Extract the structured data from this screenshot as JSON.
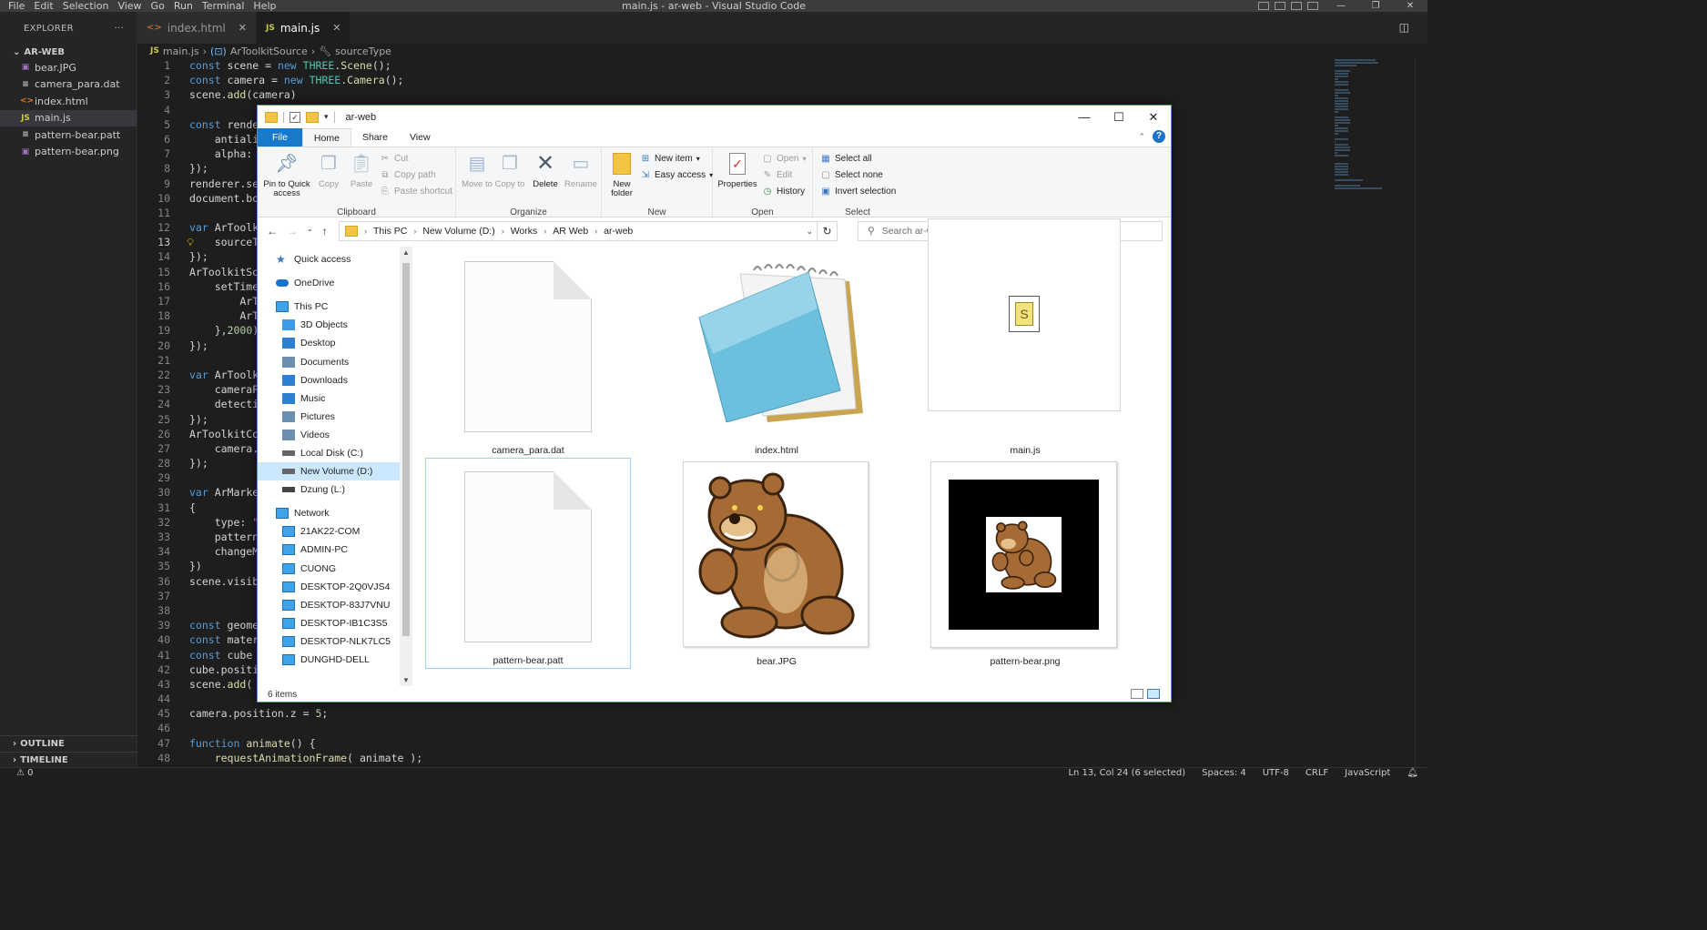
{
  "vscode": {
    "title": "main.js - ar-web - Visual Studio Code",
    "menu": [
      "File",
      "Edit",
      "Selection",
      "View",
      "Go",
      "Run",
      "Terminal",
      "Help"
    ],
    "explorer_label": "EXPLORER",
    "project": "AR-WEB",
    "files": [
      {
        "name": "bear.JPG",
        "icon": "image-icon",
        "color": "#a074c4"
      },
      {
        "name": "camera_para.dat",
        "icon": "file-icon",
        "color": "#cccccc"
      },
      {
        "name": "index.html",
        "icon": "html-icon",
        "color": "#e37933"
      },
      {
        "name": "main.js",
        "icon": "js-icon",
        "color": "#cbcb41",
        "active": true
      },
      {
        "name": "pattern-bear.patt",
        "icon": "file-icon",
        "color": "#cccccc"
      },
      {
        "name": "pattern-bear.png",
        "icon": "image-icon",
        "color": "#a074c4"
      }
    ],
    "outline_label": "OUTLINE",
    "timeline_label": "TIMELINE",
    "tabs": [
      {
        "label": "index.html",
        "icon": "html-icon"
      },
      {
        "label": "main.js",
        "icon": "js-icon",
        "active": true
      }
    ],
    "breadcrumb": [
      "main.js",
      "ArToolkitSource",
      "sourceType"
    ],
    "current_line": 13,
    "status": {
      "left": "⚠ 0",
      "position": "Ln 13, Col 24 (6 selected)",
      "spaces": "Spaces: 4",
      "encoding": "UTF-8",
      "eol": "CRLF",
      "language": "JavaScript"
    },
    "code_lines": [
      "const scene = new THREE.Scene();",
      "const camera = new THREE.Camera();",
      "scene.add(camera)",
      "",
      "const render",
      "    antiali",
      "    alpha: ",
      "});",
      "renderer.se",
      "document.bo",
      "",
      "var ArToolk",
      "    sourceTy",
      "});",
      "ArToolkitSo",
      "    setTime",
      "        ArT",
      "        ArT",
      "    },2000)",
      "});",
      "",
      "var ArToolk",
      "    cameraPa",
      "    detectio",
      "});",
      "ArToolkitCo",
      "    camera.",
      "});",
      "",
      "var ArMarke",
      "{",
      "    type: \"",
      "    patternU",
      "    changeMa",
      "})",
      "scene.visib",
      "",
      "",
      "const geome",
      "const mater",
      "const cube ",
      "cube.positi",
      "scene.add( ",
      "",
      "camera.position.z = 5;",
      "",
      "function animate() {",
      "    requestAnimationFrame( animate );",
      ""
    ]
  },
  "file_explorer": {
    "title": "ar-web",
    "ribbon_tabs": [
      "File",
      "Home",
      "Share",
      "View"
    ],
    "clipboard": {
      "label": "Clipboard",
      "pin": "Pin to Quick access",
      "copy": "Copy",
      "paste": "Paste",
      "cut": "Cut",
      "copy_path": "Copy path",
      "paste_shortcut": "Paste shortcut"
    },
    "organize": {
      "label": "Organize",
      "move_to": "Move to",
      "copy_to": "Copy to",
      "delete": "Delete",
      "rename": "Rename"
    },
    "new": {
      "label": "New",
      "new_folder": "New folder",
      "new_item": "New item",
      "easy_access": "Easy access"
    },
    "open": {
      "label": "Open",
      "properties": "Properties",
      "open": "Open",
      "edit": "Edit",
      "history": "History"
    },
    "select": {
      "label": "Select",
      "select_all": "Select all",
      "select_none": "Select none",
      "invert": "Invert selection"
    },
    "address": [
      "This PC",
      "New Volume (D:)",
      "Works",
      "AR Web",
      "ar-web"
    ],
    "search_placeholder": "Search ar-web",
    "nav": {
      "quick_access": "Quick access",
      "onedrive": "OneDrive",
      "this_pc": "This PC",
      "pc_items": [
        "3D Objects",
        "Desktop",
        "Documents",
        "Downloads",
        "Music",
        "Pictures",
        "Videos",
        "Local Disk (C:)",
        "New Volume (D:)",
        "Dzung (L:)"
      ],
      "network": "Network",
      "network_items": [
        "21AK22-COM",
        "ADMIN-PC",
        "CUONG",
        "DESKTOP-2Q0VJS4",
        "DESKTOP-83J7VNU",
        "DESKTOP-IB1C3S5",
        "DESKTOP-NLK7LC5",
        "DUNGHD-DELL"
      ]
    },
    "items": [
      "camera_para.dat",
      "index.html",
      "main.js",
      "pattern-bear.patt",
      "bear.JPG",
      "pattern-bear.png"
    ],
    "item_count": "6 items"
  }
}
